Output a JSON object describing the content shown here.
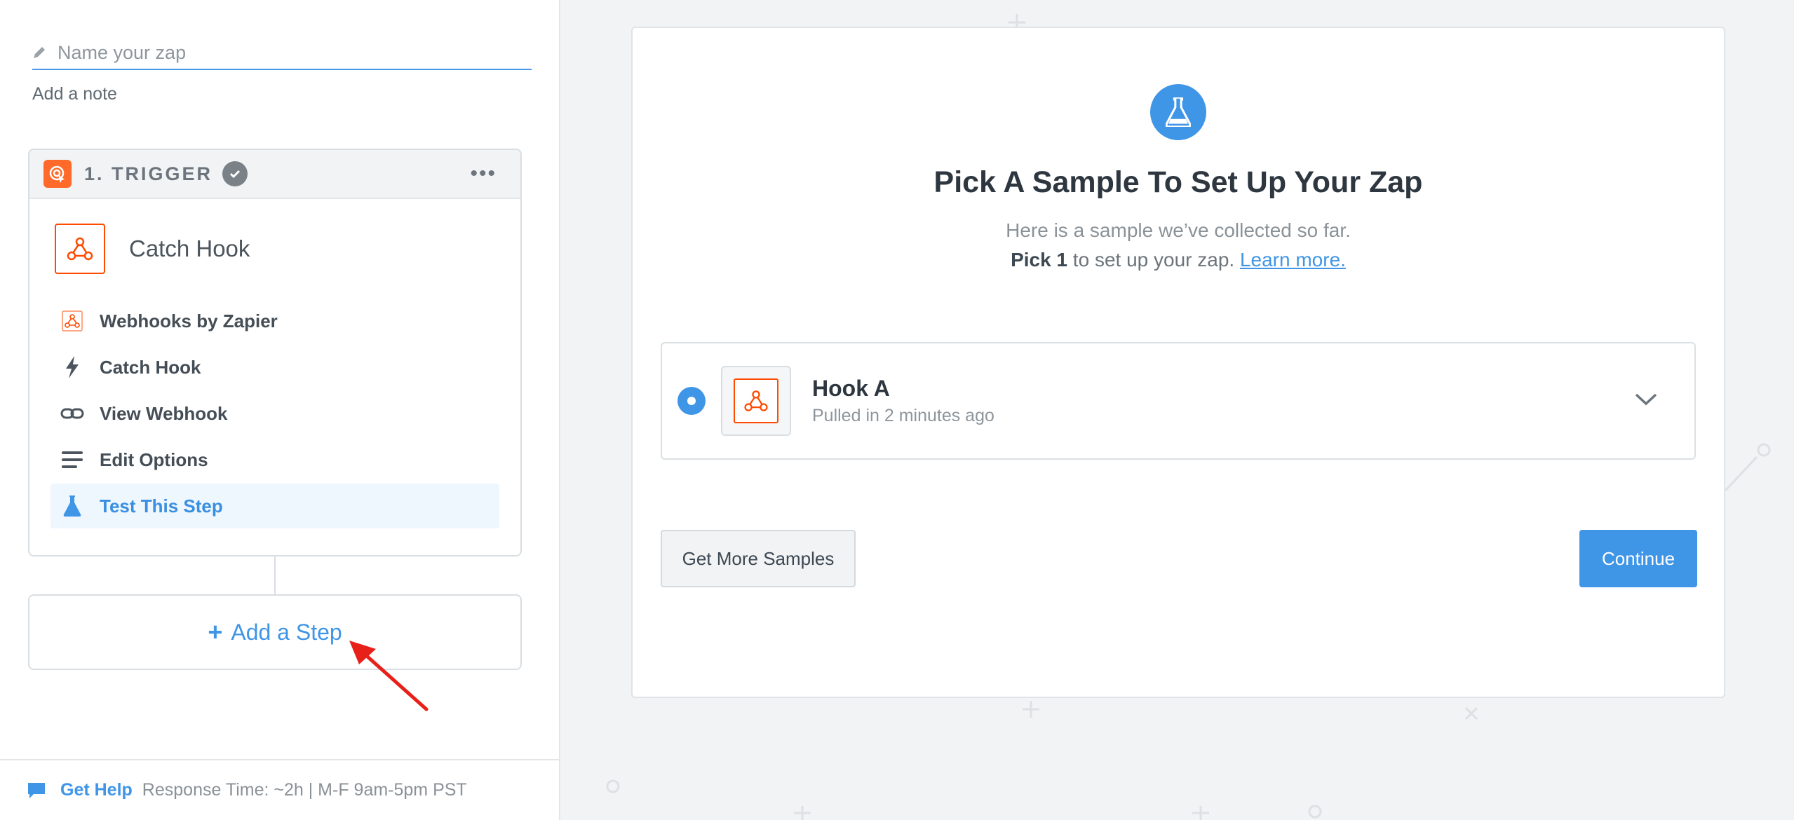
{
  "sidebar": {
    "zap_name_placeholder": "Name your zap",
    "add_note": "Add a note",
    "trigger": {
      "title": "1. TRIGGER",
      "app_title": "Catch Hook",
      "menu": [
        {
          "label": "Webhooks by Zapier",
          "icon": "webhook-icon"
        },
        {
          "label": "Catch Hook",
          "icon": "lightning-icon"
        },
        {
          "label": "View Webhook",
          "icon": "link-icon"
        },
        {
          "label": "Edit Options",
          "icon": "lines-icon"
        },
        {
          "label": "Test This Step",
          "icon": "flask-icon",
          "active": true
        }
      ]
    },
    "add_step": {
      "plus": "+",
      "label": "Add a Step"
    },
    "help": {
      "link": "Get Help",
      "info": "Response Time: ~2h | M-F 9am-5pm PST"
    }
  },
  "main": {
    "title": "Pick A Sample To Set Up Your Zap",
    "subtitle_line1": "Here is a sample we’ve collected so far.",
    "subtitle_pick": "Pick 1",
    "subtitle_rest": " to set up your zap. ",
    "learn_more": "Learn more.",
    "sample": {
      "name": "Hook A",
      "meta": "Pulled in 2 minutes ago",
      "selected": true
    },
    "buttons": {
      "more_samples": "Get More Samples",
      "continue": "Continue"
    }
  },
  "colors": {
    "accent": "#3f95e6",
    "zapier_orange": "#ff4a00",
    "annotation_red": "#e8201a"
  }
}
